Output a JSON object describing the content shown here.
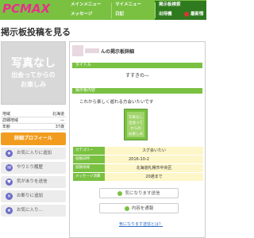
{
  "header": {
    "logo": "PCMAX",
    "nav": [
      {
        "label": "メインメニュー"
      },
      {
        "label": "マイメニュー"
      },
      {
        "label": "掲示板検索"
      },
      {
        "label": "メッセージ"
      },
      {
        "label": "日記"
      },
      {
        "label": "出待機"
      },
      {
        "label": "最新情報"
      }
    ]
  },
  "page_title": "掲示板投稿を見る",
  "sidebar": {
    "photo_text_main": "写真なし",
    "photo_text_sub": "出会ってからの\nお楽しみ",
    "info": [
      {
        "key": "地域",
        "value": "北海道"
      },
      {
        "key": "詳細地域",
        "value": "—"
      },
      {
        "key": "年齢",
        "value": "37歳"
      }
    ],
    "profile_button": "詳細プロフィール",
    "buttons": [
      {
        "label": "お気に入りに追加",
        "icon": "star-icon"
      },
      {
        "label": "やりとり履歴",
        "icon": "chat-icon"
      },
      {
        "label": "気がありを送信",
        "icon": "heart-icon"
      },
      {
        "label": "お断りに追加",
        "icon": "block-icon"
      },
      {
        "label": "お気に入り…",
        "icon": "star-icon"
      }
    ]
  },
  "main": {
    "title_suffix": "んの掲示板詳細",
    "title_label": "タイトル",
    "title_value": "すすきの—",
    "content_label": "掲示板内容",
    "content_text": "これから楽しく遊れる方会いたいです",
    "thumb_text": "写真なし\n出会って\nからの\nお楽しみ",
    "details": [
      {
        "key": "カテゴリー",
        "value": "スグ会いたい"
      },
      {
        "key": "投稿日時",
        "value": "2016-10-2"
      },
      {
        "key": "投稿地域",
        "value": "北海道札幌市中央区"
      },
      {
        "key": "メッセージ消費",
        "value": "20通まで"
      }
    ],
    "actions": [
      {
        "label": "気になります送信"
      },
      {
        "label": "内容を通報"
      }
    ],
    "report_link": "気になります送信とは？"
  },
  "colors": {
    "header_green": "#7ac142",
    "logo_pink": "#e8308a",
    "accent_orange": "#f29c1f",
    "detail_bg": "#fdf6c8"
  }
}
